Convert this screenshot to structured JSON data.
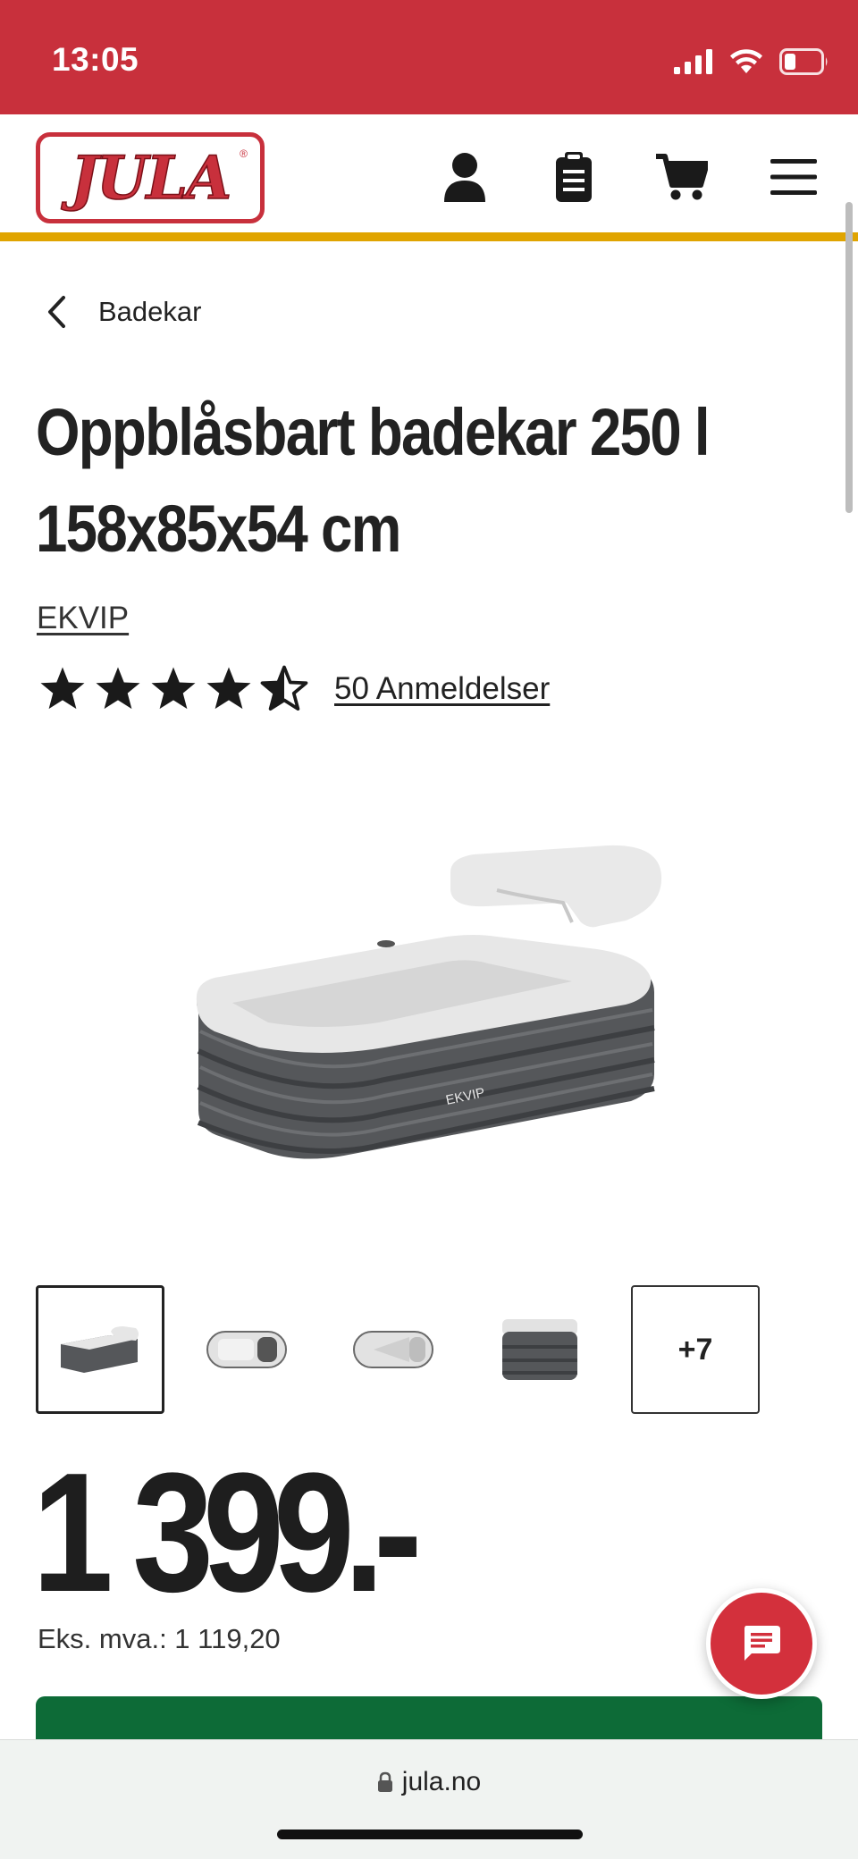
{
  "status_bar": {
    "time": "13:05"
  },
  "header": {
    "logo_text": "JULA",
    "logo_reg": "®"
  },
  "breadcrumb": {
    "label": "Badekar"
  },
  "product": {
    "title": "Oppblåsbart badekar 250 l 158x85x54 cm",
    "brand": "EKVIP",
    "rating": 4.5,
    "rating_max": 5,
    "reviews_label": "50 Anmeldelser",
    "image_brand_text": "EKVIP",
    "more_images_label": "+7",
    "price": "1 399.-",
    "price_ex_vat": "Eks. mva.: 1 119,20"
  },
  "browser": {
    "url": "jula.no"
  },
  "colors": {
    "brand_red": "#c8303c",
    "accent_yellow": "#e0a400",
    "buy_green": "#0d6b37"
  }
}
